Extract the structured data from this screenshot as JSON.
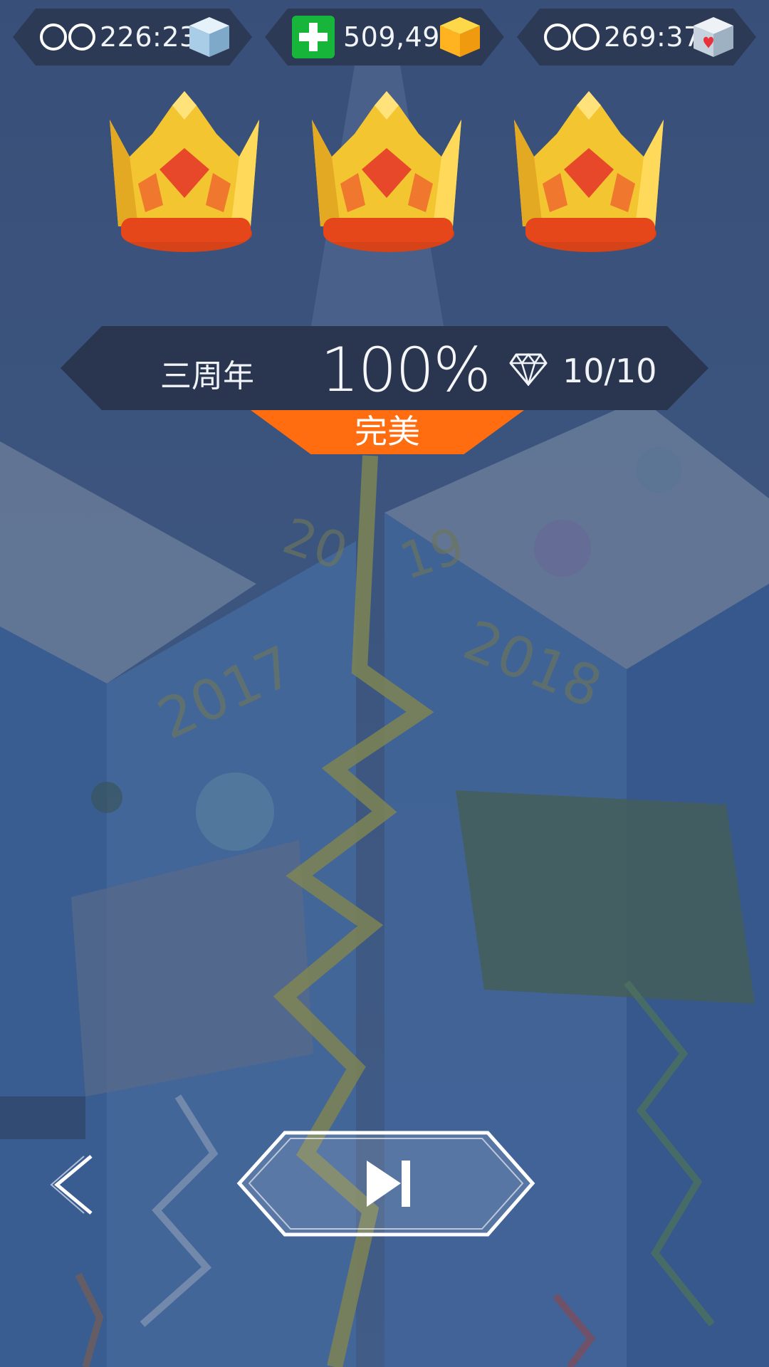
{
  "top_bar": {
    "left": {
      "value": "226:23",
      "infinity_icon": "infinity-icon",
      "cube_icon": "blue-cube-icon"
    },
    "center": {
      "value": "509,490",
      "add_icon": "green-plus-icon",
      "gem_icon": "orange-gem-cube-icon"
    },
    "right": {
      "value": "269:37",
      "infinity_icon": "infinity-icon",
      "cube_icon": "heart-cube-icon"
    }
  },
  "result": {
    "crowns_earned": 3,
    "crowns_total": 3,
    "level_name": "三周年",
    "percent": "100%",
    "gems": "10/10",
    "rating": "完美"
  },
  "controls": {
    "back_icon": "chevron-left-icon",
    "next_icon": "skip-next-icon"
  },
  "colors": {
    "accent": "#ff6d10",
    "banner": "#2a3550",
    "crown_gold": "#f2c531",
    "crown_band": "#e4481a"
  }
}
